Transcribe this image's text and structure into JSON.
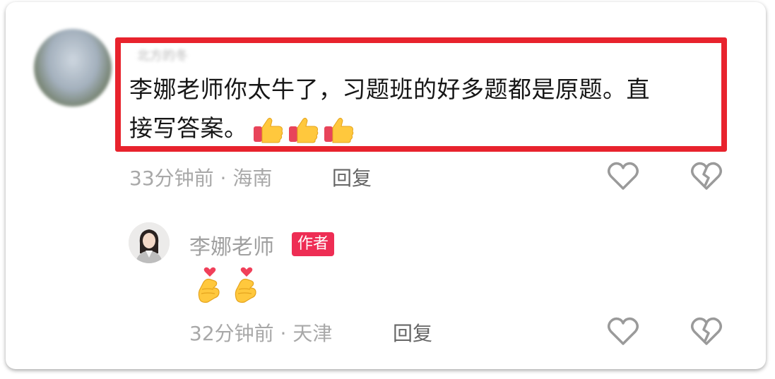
{
  "comment": {
    "username_blurred": "北方的冬",
    "text_line1": "李娜老师你太牛了，习题班的好多题都是原题。直",
    "text_line2": "接写答案。",
    "emojis": [
      "thumbs-up",
      "thumbs-up",
      "thumbs-up"
    ],
    "time_location": "33分钟前 · 海南",
    "reply_label": "回复"
  },
  "author_reply": {
    "name": "李娜老师",
    "badge": "作者",
    "emojis": [
      "heart-hands",
      "heart-hands"
    ],
    "time_location": "32分钟前 · 天津",
    "reply_label": "回复"
  },
  "colors": {
    "highlight_border": "#e8232d",
    "badge_bg": "#ee2d54",
    "meta_text": "#a8a8a8"
  }
}
